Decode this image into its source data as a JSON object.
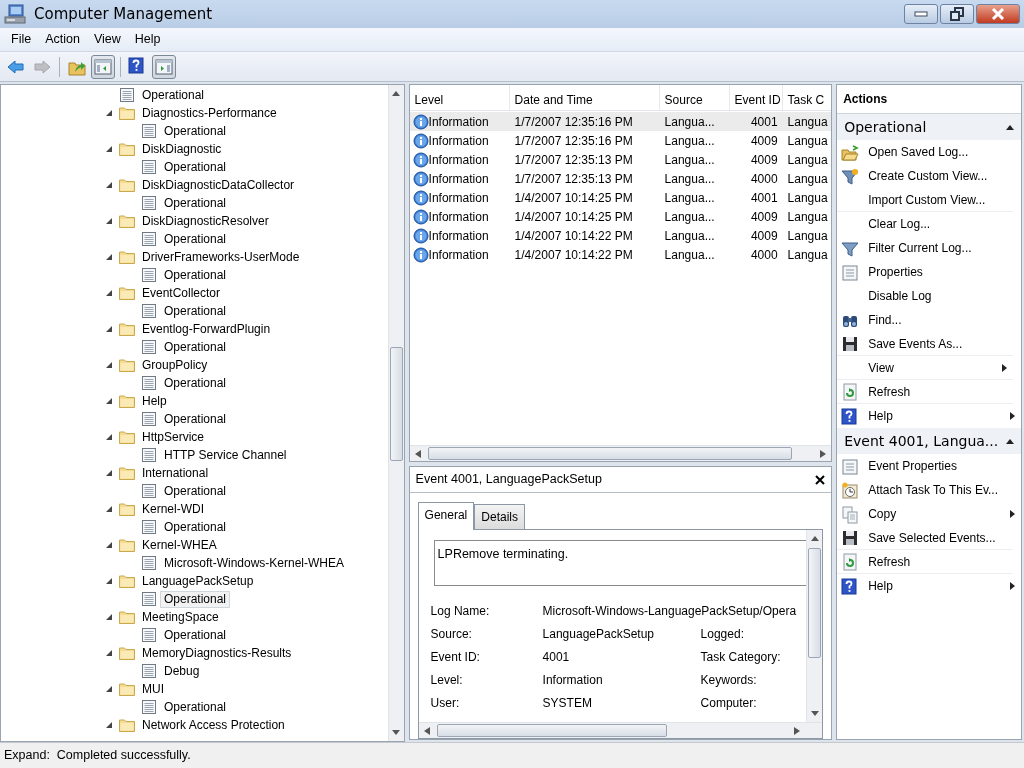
{
  "window": {
    "title": "Computer Management"
  },
  "menu": [
    "File",
    "Action",
    "View",
    "Help"
  ],
  "toolbar": [
    [
      {
        "kind": "back",
        "disabled": false,
        "pressed": false
      },
      {
        "kind": "forward",
        "disabled": true,
        "pressed": false
      }
    ],
    [
      {
        "kind": "up",
        "disabled": false,
        "pressed": false
      },
      {
        "kind": "console-tree",
        "disabled": false,
        "pressed": true
      }
    ],
    [
      {
        "kind": "help",
        "disabled": false,
        "pressed": false
      },
      {
        "kind": "action-pane",
        "disabled": false,
        "pressed": true
      }
    ]
  ],
  "tree": [
    {
      "label": "Operational",
      "kind": "log",
      "selected": false
    },
    {
      "label": "Diagnostics-Performance",
      "kind": "folder",
      "expanded": true,
      "selected": false,
      "children": [
        {
          "label": "Operational",
          "kind": "log",
          "selected": false
        }
      ]
    },
    {
      "label": "DiskDiagnostic",
      "kind": "folder",
      "expanded": true,
      "selected": false,
      "children": [
        {
          "label": "Operational",
          "kind": "log",
          "selected": false
        }
      ]
    },
    {
      "label": "DiskDiagnosticDataCollector",
      "kind": "folder",
      "expanded": true,
      "selected": false,
      "children": [
        {
          "label": "Operational",
          "kind": "log",
          "selected": false
        }
      ]
    },
    {
      "label": "DiskDiagnosticResolver",
      "kind": "folder",
      "expanded": true,
      "selected": false,
      "children": [
        {
          "label": "Operational",
          "kind": "log",
          "selected": false
        }
      ]
    },
    {
      "label": "DriverFrameworks-UserMode",
      "kind": "folder",
      "expanded": true,
      "selected": false,
      "children": [
        {
          "label": "Operational",
          "kind": "log",
          "selected": false
        }
      ]
    },
    {
      "label": "EventCollector",
      "kind": "folder",
      "expanded": true,
      "selected": false,
      "children": [
        {
          "label": "Operational",
          "kind": "log",
          "selected": false
        }
      ]
    },
    {
      "label": "Eventlog-ForwardPlugin",
      "kind": "folder",
      "expanded": true,
      "selected": false,
      "children": [
        {
          "label": "Operational",
          "kind": "log",
          "selected": false
        }
      ]
    },
    {
      "label": "GroupPolicy",
      "kind": "folder",
      "expanded": true,
      "selected": false,
      "children": [
        {
          "label": "Operational",
          "kind": "log",
          "selected": false
        }
      ]
    },
    {
      "label": "Help",
      "kind": "folder",
      "expanded": true,
      "selected": false,
      "children": [
        {
          "label": "Operational",
          "kind": "log",
          "selected": false
        }
      ]
    },
    {
      "label": "HttpService",
      "kind": "folder",
      "expanded": true,
      "selected": false,
      "children": [
        {
          "label": "HTTP Service Channel",
          "kind": "log",
          "selected": false
        }
      ]
    },
    {
      "label": "International",
      "kind": "folder",
      "expanded": true,
      "selected": false,
      "children": [
        {
          "label": "Operational",
          "kind": "log",
          "selected": false
        }
      ]
    },
    {
      "label": "Kernel-WDI",
      "kind": "folder",
      "expanded": true,
      "selected": false,
      "children": [
        {
          "label": "Operational",
          "kind": "log",
          "selected": false
        }
      ]
    },
    {
      "label": "Kernel-WHEA",
      "kind": "folder",
      "expanded": true,
      "selected": false,
      "children": [
        {
          "label": "Microsoft-Windows-Kernel-WHEA",
          "kind": "log",
          "selected": false
        }
      ]
    },
    {
      "label": "LanguagePackSetup",
      "kind": "folder",
      "expanded": true,
      "selected": false,
      "children": [
        {
          "label": "Operational",
          "kind": "log",
          "selected": true
        }
      ]
    },
    {
      "label": "MeetingSpace",
      "kind": "folder",
      "expanded": true,
      "selected": false,
      "children": [
        {
          "label": "Operational",
          "kind": "log",
          "selected": false
        }
      ]
    },
    {
      "label": "MemoryDiagnostics-Results",
      "kind": "folder",
      "expanded": true,
      "selected": false,
      "children": [
        {
          "label": "Debug",
          "kind": "log",
          "selected": false
        }
      ]
    },
    {
      "label": "MUI",
      "kind": "folder",
      "expanded": true,
      "selected": false,
      "children": [
        {
          "label": "Operational",
          "kind": "log",
          "selected": false
        }
      ]
    },
    {
      "label": "Network Access Protection",
      "kind": "folder",
      "expanded": true,
      "selected": false
    }
  ],
  "events": {
    "columns": [
      "Level",
      "Date and Time",
      "Source",
      "Event ID",
      "Task C"
    ],
    "rows": [
      {
        "kind": "information",
        "level": "Information",
        "date": "1/7/2007 12:35:16 PM",
        "source": "Langua...",
        "event_id": "4001",
        "task": "Langua",
        "selected": true
      },
      {
        "kind": "information",
        "level": "Information",
        "date": "1/7/2007 12:35:16 PM",
        "source": "Langua...",
        "event_id": "4009",
        "task": "Langua",
        "selected": false
      },
      {
        "kind": "information",
        "level": "Information",
        "date": "1/7/2007 12:35:13 PM",
        "source": "Langua...",
        "event_id": "4009",
        "task": "Langua",
        "selected": false
      },
      {
        "kind": "information",
        "level": "Information",
        "date": "1/7/2007 12:35:13 PM",
        "source": "Langua...",
        "event_id": "4000",
        "task": "Langua",
        "selected": false
      },
      {
        "kind": "information",
        "level": "Information",
        "date": "1/4/2007 10:14:25 PM",
        "source": "Langua...",
        "event_id": "4001",
        "task": "Langua",
        "selected": false
      },
      {
        "kind": "information",
        "level": "Information",
        "date": "1/4/2007 10:14:25 PM",
        "source": "Langua...",
        "event_id": "4009",
        "task": "Langua",
        "selected": false
      },
      {
        "kind": "information",
        "level": "Information",
        "date": "1/4/2007 10:14:22 PM",
        "source": "Langua...",
        "event_id": "4009",
        "task": "Langua",
        "selected": false
      },
      {
        "kind": "information",
        "level": "Information",
        "date": "1/4/2007 10:14:22 PM",
        "source": "Langua...",
        "event_id": "4000",
        "task": "Langua",
        "selected": false
      }
    ]
  },
  "detail": {
    "title": "Event 4001, LanguagePackSetup",
    "tabs": [
      {
        "label": "General",
        "selected": true
      },
      {
        "label": "Details",
        "selected": false
      }
    ],
    "message": "LPRemove terminating.",
    "fields": [
      {
        "label": "Log Name:",
        "value": "Microsoft-Windows-LanguagePackSetup/Opera"
      },
      {
        "label": "Source:",
        "value": "LanguagePackSetup",
        "label_2": "Logged:"
      },
      {
        "label": "Event ID:",
        "value": "4001",
        "label_2": "Task Category:"
      },
      {
        "label": "Level:",
        "value": "Information",
        "label_2": "Keywords:"
      },
      {
        "label": "User:",
        "value": "SYSTEM",
        "label_2": "Computer:"
      }
    ]
  },
  "actions": {
    "title": "Actions",
    "sections": [
      {
        "title": "Operational",
        "expanded": true,
        "items": [
          {
            "label": "Open Saved Log...",
            "kind": "open",
            "submenu": false,
            "separator_after": false
          },
          {
            "label": "Create Custom View...",
            "kind": "create-filter",
            "submenu": false,
            "separator_after": false
          },
          {
            "label": "Import Custom View...",
            "kind": "plain",
            "submenu": false,
            "separator_after": true
          },
          {
            "label": "Clear Log...",
            "kind": "plain",
            "submenu": false,
            "separator_after": false
          },
          {
            "label": "Filter Current Log...",
            "kind": "filter",
            "submenu": false,
            "separator_after": false
          },
          {
            "label": "Properties",
            "kind": "properties",
            "submenu": false,
            "separator_after": false
          },
          {
            "label": "Disable Log",
            "kind": "plain",
            "submenu": false,
            "separator_after": false
          },
          {
            "label": "Find...",
            "kind": "find",
            "submenu": false,
            "separator_after": false
          },
          {
            "label": "Save Events As...",
            "kind": "save",
            "submenu": false,
            "separator_after": true
          },
          {
            "label": "View",
            "kind": "plain",
            "submenu": true,
            "separator_after": true
          },
          {
            "label": "Refresh",
            "kind": "refresh",
            "submenu": false,
            "separator_after": true
          },
          {
            "label": "Help",
            "kind": "help",
            "submenu": true,
            "separator_after": false
          }
        ]
      },
      {
        "title": "Event 4001, Langua...",
        "expanded": true,
        "items": [
          {
            "label": "Event Properties",
            "kind": "properties",
            "submenu": false,
            "separator_after": false
          },
          {
            "label": "Attach Task To This Ev...",
            "kind": "task",
            "submenu": false,
            "separator_after": false
          },
          {
            "label": "Copy",
            "kind": "copy",
            "submenu": true,
            "separator_after": false
          },
          {
            "label": "Save Selected Events...",
            "kind": "save",
            "submenu": false,
            "separator_after": true
          },
          {
            "label": "Refresh",
            "kind": "refresh",
            "submenu": false,
            "separator_after": true
          },
          {
            "label": "Help",
            "kind": "help",
            "submenu": true,
            "separator_after": false
          }
        ]
      }
    ]
  },
  "status_bar": "Expand:  Completed successfully."
}
